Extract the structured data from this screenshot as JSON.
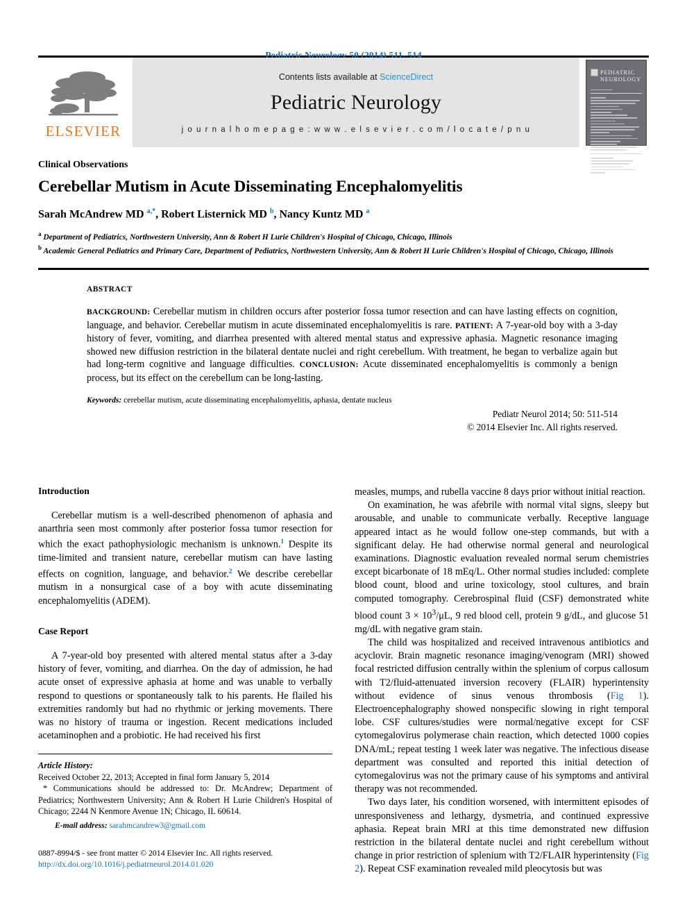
{
  "running_head": "Pediatric Neurology 50 (2014) 511–514",
  "masthead": {
    "publisher_name": "ELSEVIER",
    "contents_prefix": "Contents lists available at ",
    "contents_link": "ScienceDirect",
    "journal_name": "Pediatric Neurology",
    "homepage": "j o u r n a l   h o m e p a g e :   w w w . e l s e v i e r . c o m / l o c a t e / p n u",
    "cover_title_line1": "PEDIATRIC",
    "cover_title_line2": "NEUROLOGY"
  },
  "article": {
    "section_kicker": "Clinical Observations",
    "title": "Cerebellar Mutism in Acute Disseminating Encephalomyelitis",
    "authors_html": "Sarah McAndrew MD <sup>a,*</sup>, Robert Listernick MD <sup>b</sup>, Nancy Kuntz MD <sup>a</sup>",
    "affiliation_a": "Department of Pediatrics, Northwestern University, Ann & Robert H Lurie Children's Hospital of Chicago, Chicago, Illinois",
    "affiliation_b": "Academic General Pediatrics and Primary Care, Department of Pediatrics, Northwestern University, Ann & Robert H Lurie Children's Hospital of Chicago, Chicago, Illinois"
  },
  "abstract": {
    "label": "ABSTRACT",
    "background_label": "BACKGROUND:",
    "background_text": " Cerebellar mutism in children occurs after posterior fossa tumor resection and can have lasting effects on cognition, language, and behavior. Cerebellar mutism in acute disseminated encephalomyelitis is rare. ",
    "patient_label": "PATIENT:",
    "patient_text": " A 7-year-old boy with a 3-day history of fever, vomiting, and diarrhea presented with altered mental status and expressive aphasia. Magnetic resonance imaging showed new diffusion restriction in the bilateral dentate nuclei and right cerebellum. With treatment, he began to verbalize again but had long-term cognitive and language difficulties. ",
    "conclusion_label": "CONCLUSION:",
    "conclusion_text": " Acute disseminated encephalomyelitis is commonly a benign process, but its effect on the cerebellum can be long-lasting.",
    "keywords_label": "Keywords:",
    "keywords_text": " cerebellar mutism, acute disseminating encephalomyelitis, aphasia, dentate nucleus",
    "citation": "Pediatr Neurol 2014; 50: 511-514",
    "copyright": "© 2014 Elsevier Inc. All rights reserved."
  },
  "body": {
    "introduction_heading": "Introduction",
    "intro_p1_a": "Cerebellar mutism is a well-described phenomenon of aphasia and anarthria seen most commonly after posterior fossa tumor resection for which the exact pathophysiologic mechanism is unknown.",
    "intro_ref1": "1",
    "intro_p1_b": " Despite its time-limited and transient nature, cerebellar mutism can have lasting effects on cognition, language, and behavior.",
    "intro_ref2": "2",
    "intro_p1_c": " We describe cerebellar mutism in a nonsurgical case of a boy with acute disseminating encephalomyelitis (ADEM).",
    "case_heading": "Case Report",
    "case_p1": "A 7-year-old boy presented with altered mental status after a 3-day history of fever, vomiting, and diarrhea. On the day of admission, he had acute onset of expressive aphasia at home and was unable to verbally respond to questions or spontaneously talk to his parents. He flailed his extremities randomly but had no rhythmic or jerking movements. There was no history of trauma or ingestion. Recent medications included acetaminophen and a probiotic. He had received his first",
    "right_p1_cont": "measles, mumps, and rubella vaccine 8 days prior without initial reaction.",
    "right_p2": "On examination, he was afebrile with normal vital signs, sleepy but arousable, and unable to communicate verbally. Receptive language appeared intact as he would follow one-step commands, but with a significant delay. He had otherwise normal general and neurological examinations. Diagnostic evaluation revealed normal serum chemistries except bicarbonate of 18 mEq/L. Other normal studies included: complete blood count, blood and urine toxicology, stool cultures, and brain computed tomography. Cerebrospinal fluid (CSF) demonstrated white blood count 3 × 10",
    "right_p2_sup": "3",
    "right_p2_b": "/μL, 9 red blood cell, protein 9 g/dL, and glucose 51 mg/dL with negative gram stain.",
    "right_p3_a": "The child was hospitalized and received intravenous antibiotics and acyclovir. Brain magnetic resonance imaging/venogram (MRI) showed focal restricted diffusion centrally within the splenium of corpus callosum with T2/fluid-attenuated inversion recovery (FLAIR) hyperintensity without evidence of sinus venous thrombosis (",
    "right_p3_fig1": "Fig 1",
    "right_p3_b": "). Electroencephalography showed nonspecific slowing in right temporal lobe. CSF cultures/studies were normal/negative except for CSF cytomegalovirus polymerase chain reaction, which detected 1000 copies DNA/mL; repeat testing 1 week later was negative. The infectious disease department was consulted and reported this initial detection of cytomegalovirus was not the primary cause of his symptoms and antiviral therapy was not recommended.",
    "right_p4_a": "Two days later, his condition worsened, with intermittent episodes of unresponsiveness and lethargy, dysmetria, and continued expressive aphasia. Repeat brain MRI at this time demonstrated new diffusion restriction in the bilateral dentate nuclei and right cerebellum without change in prior restriction of splenium with T2/FLAIR hyperintensity (",
    "right_p4_fig2": "Fig 2",
    "right_p4_b": "). Repeat CSF examination revealed mild pleocytosis but was"
  },
  "footnotes": {
    "history_label": "Article History:",
    "history_text": "Received October 22, 2013; Accepted in final form January 5, 2014",
    "correspondence": "* Communications should be addressed to: Dr. McAndrew; Department of Pediatrics; Northwestern University; Ann & Robert H Lurie Children's Hospital of Chicago; 2244 N Kenmore Avenue 1N; Chicago, IL 60614.",
    "email_label": "E-mail address:",
    "email": "sarahmcandrew3@gmail.com"
  },
  "footer": {
    "issn_line": "0887-8994/$ - see front matter © 2014 Elsevier Inc. All rights reserved.",
    "doi": "http://dx.doi.org/10.1016/j.pediatrneurol.2014.01.020"
  },
  "colors": {
    "link": "#1a6fa8",
    "sciencedirect": "#2a8fd0",
    "elsevier_orange": "#E87722",
    "band_gray": "#e4e4e4"
  }
}
